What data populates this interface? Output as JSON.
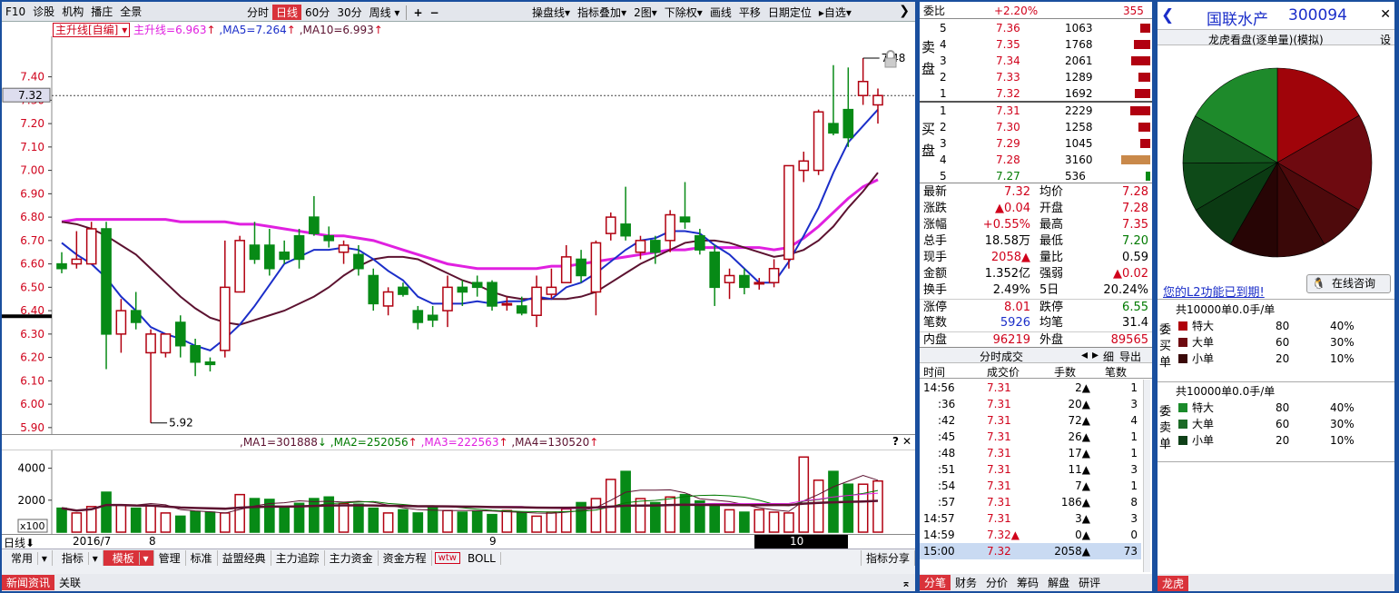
{
  "toolbar": {
    "left": [
      "F10",
      "诊股",
      "机构",
      "播庄",
      "全景"
    ],
    "periods": [
      "分时",
      "日线",
      "60分",
      "30分",
      "周线"
    ],
    "active_period": "日线",
    "zoom_in": "+",
    "zoom_out": "−",
    "right": [
      "操盘线",
      "指标叠加",
      "2图",
      "下除权",
      "画线",
      "平移",
      "日期定位",
      "自选"
    ],
    "collapse": "❯"
  },
  "legend": {
    "main_box": "主升线[自编]",
    "items": [
      {
        "text": "主升线=6.963",
        "color": "#e020e0",
        "arrow": "↑"
      },
      {
        "text": "MA5=7.264",
        "color": "#1b2ec9",
        "arrow": "↑"
      },
      {
        "text": "MA10=6.993",
        "color": "#5c1230",
        "arrow": "↑"
      }
    ]
  },
  "price_axis": {
    "labels": [
      "7.40",
      "7.30",
      "7.20",
      "7.10",
      "7.00",
      "6.90",
      "6.80",
      "6.70",
      "6.60",
      "6.50",
      "6.40",
      "6.30",
      "6.20",
      "6.10",
      "6.00",
      "5.90"
    ],
    "current": "7.32",
    "high_label": "7.48",
    "low_label": "5.92"
  },
  "chart_data": {
    "type": "candlestick",
    "ohlc": [
      [
        6.6,
        6.65,
        6.56,
        6.58
      ],
      [
        6.6,
        6.74,
        6.58,
        6.62
      ],
      [
        6.6,
        6.78,
        6.6,
        6.75
      ],
      [
        6.75,
        6.78,
        6.15,
        6.3
      ],
      [
        6.3,
        6.45,
        6.22,
        6.4
      ],
      [
        6.4,
        6.48,
        6.32,
        6.35
      ],
      [
        6.22,
        6.32,
        5.92,
        6.3
      ],
      [
        6.22,
        6.3,
        6.2,
        6.3
      ],
      [
        6.35,
        6.38,
        6.2,
        6.25
      ],
      [
        6.25,
        6.28,
        6.12,
        6.18
      ],
      [
        6.18,
        6.2,
        6.14,
        6.17
      ],
      [
        6.23,
        6.7,
        6.2,
        6.5
      ],
      [
        6.48,
        6.72,
        6.48,
        6.7
      ],
      [
        6.68,
        6.78,
        6.6,
        6.62
      ],
      [
        6.68,
        6.75,
        6.55,
        6.58
      ],
      [
        6.65,
        6.7,
        6.6,
        6.62
      ],
      [
        6.72,
        6.75,
        6.58,
        6.62
      ],
      [
        6.8,
        6.89,
        6.72,
        6.73
      ],
      [
        6.72,
        6.76,
        6.67,
        6.7
      ],
      [
        6.65,
        6.7,
        6.6,
        6.68
      ],
      [
        6.64,
        6.68,
        6.55,
        6.58
      ],
      [
        6.55,
        6.58,
        6.4,
        6.43
      ],
      [
        6.42,
        6.5,
        6.38,
        6.48
      ],
      [
        6.5,
        6.52,
        6.46,
        6.47
      ],
      [
        6.4,
        6.42,
        6.32,
        6.35
      ],
      [
        6.38,
        6.42,
        6.33,
        6.36
      ],
      [
        6.4,
        6.55,
        6.33,
        6.5
      ],
      [
        6.5,
        6.53,
        6.42,
        6.48
      ],
      [
        6.52,
        6.55,
        6.46,
        6.5
      ],
      [
        6.52,
        6.53,
        6.4,
        6.42
      ],
      [
        6.43,
        6.46,
        6.4,
        6.43
      ],
      [
        6.42,
        6.46,
        6.38,
        6.39
      ],
      [
        6.38,
        6.55,
        6.33,
        6.5
      ],
      [
        6.47,
        6.58,
        6.45,
        6.5
      ],
      [
        6.52,
        6.68,
        6.52,
        6.63
      ],
      [
        6.62,
        6.66,
        6.52,
        6.55
      ],
      [
        6.48,
        6.7,
        6.38,
        6.69
      ],
      [
        6.73,
        6.82,
        6.7,
        6.8
      ],
      [
        6.77,
        6.93,
        6.7,
        6.72
      ],
      [
        6.65,
        6.72,
        6.62,
        6.7
      ],
      [
        6.7,
        6.72,
        6.6,
        6.65
      ],
      [
        6.7,
        6.83,
        6.65,
        6.81
      ],
      [
        6.8,
        6.95,
        6.75,
        6.78
      ],
      [
        6.72,
        6.75,
        6.64,
        6.66
      ],
      [
        6.65,
        6.68,
        6.42,
        6.5
      ],
      [
        6.52,
        6.58,
        6.45,
        6.55
      ],
      [
        6.55,
        6.58,
        6.47,
        6.5
      ],
      [
        6.52,
        6.54,
        6.49,
        6.52
      ],
      [
        6.52,
        6.62,
        6.5,
        6.58
      ],
      [
        6.62,
        7.02,
        6.58,
        7.02
      ],
      [
        7.0,
        7.08,
        6.95,
        7.04
      ],
      [
        7.0,
        7.26,
        6.98,
        7.25
      ],
      [
        7.2,
        7.45,
        7.15,
        7.16
      ],
      [
        7.26,
        7.44,
        7.1,
        7.14
      ],
      [
        7.32,
        7.48,
        7.28,
        7.38
      ],
      [
        7.28,
        7.35,
        7.2,
        7.32
      ]
    ],
    "ma5": [
      6.69,
      6.64,
      6.6,
      6.54,
      6.46,
      6.4,
      6.33,
      6.3,
      6.28,
      6.25,
      6.23,
      6.28,
      6.34,
      6.42,
      6.51,
      6.6,
      6.63,
      6.66,
      6.66,
      6.67,
      6.66,
      6.62,
      6.57,
      6.53,
      6.46,
      6.43,
      6.43,
      6.43,
      6.44,
      6.43,
      6.44,
      6.44,
      6.46,
      6.45,
      6.5,
      6.52,
      6.56,
      6.61,
      6.66,
      6.7,
      6.71,
      6.74,
      6.74,
      6.73,
      6.68,
      6.64,
      6.58,
      6.52,
      6.52,
      6.61,
      6.72,
      6.84,
      6.99,
      7.12,
      7.19,
      7.26
    ],
    "ma10": [
      6.78,
      6.77,
      6.75,
      6.72,
      6.68,
      6.64,
      6.58,
      6.52,
      6.46,
      6.41,
      6.37,
      6.35,
      6.34,
      6.36,
      6.38,
      6.4,
      6.43,
      6.46,
      6.5,
      6.55,
      6.59,
      6.62,
      6.63,
      6.63,
      6.62,
      6.59,
      6.56,
      6.53,
      6.51,
      6.48,
      6.46,
      6.45,
      6.45,
      6.45,
      6.45,
      6.46,
      6.48,
      6.52,
      6.56,
      6.6,
      6.63,
      6.66,
      6.69,
      6.7,
      6.7,
      6.69,
      6.67,
      6.65,
      6.63,
      6.64,
      6.66,
      6.7,
      6.76,
      6.84,
      6.91,
      6.99
    ],
    "main": [
      6.78,
      6.79,
      6.79,
      6.79,
      6.79,
      6.79,
      6.79,
      6.79,
      6.78,
      6.78,
      6.78,
      6.78,
      6.77,
      6.77,
      6.76,
      6.75,
      6.74,
      6.73,
      6.72,
      6.72,
      6.71,
      6.7,
      6.68,
      6.66,
      6.64,
      6.62,
      6.6,
      6.59,
      6.58,
      6.58,
      6.58,
      6.58,
      6.58,
      6.59,
      6.59,
      6.6,
      6.61,
      6.62,
      6.63,
      6.64,
      6.65,
      6.66,
      6.66,
      6.67,
      6.67,
      6.67,
      6.67,
      6.67,
      6.66,
      6.67,
      6.71,
      6.76,
      6.82,
      6.88,
      6.93,
      6.96
    ],
    "volume": [
      1500,
      1200,
      1600,
      2500,
      1700,
      1500,
      1650,
      1200,
      1000,
      1300,
      1250,
      1200,
      2350,
      2100,
      2050,
      1500,
      1800,
      2100,
      2200,
      1800,
      1750,
      1500,
      1200,
      1400,
      1200,
      1600,
      1350,
      1250,
      1300,
      1100,
      1350,
      1200,
      1000,
      1250,
      1450,
      1850,
      2100,
      3300,
      3800,
      2100,
      1850,
      2200,
      2350,
      1950,
      1650,
      1400,
      1250,
      1400,
      1250,
      1200,
      4700,
      3250,
      3800,
      3000,
      3000,
      3200
    ],
    "vol_ylim": [
      0,
      5000
    ],
    "ylim": [
      5.88,
      7.48
    ]
  },
  "volume_panel": {
    "legend": [
      {
        "text": "MA1=301888",
        "color": "#5c1230",
        "arrow": "↓"
      },
      {
        "text": "MA2=252056",
        "color": "#007a00",
        "arrow": "↑"
      },
      {
        "text": "MA3=222563",
        "color": "#e020e0",
        "arrow": "↑"
      },
      {
        "text": "MA4=130520",
        "color": "#5c1230",
        "arrow": "↑"
      }
    ],
    "y_labels": [
      "4000",
      "2000"
    ],
    "unit": "x100"
  },
  "time_axis": {
    "period": "日线",
    "labels": [
      "2016/7",
      "8",
      "9",
      "10"
    ]
  },
  "bottom_tabs": [
    "常用",
    "指标",
    "模板",
    "管理",
    "标准",
    "益盟经典",
    "主力追踪",
    "主力资金",
    "资金方程",
    "wtw",
    "BOLL",
    "指标分享"
  ],
  "news_tabs": [
    "新闻资讯",
    "关联"
  ],
  "quote": {
    "weibi_label": "委比",
    "weibi_value": "+2.20%",
    "weibi_count": "355",
    "sell_label": [
      "卖",
      "盘"
    ],
    "buy_label": [
      "买",
      "盘"
    ],
    "sells": [
      {
        "n": "5",
        "price": "7.36",
        "vol": "1063",
        "bar": 0.34
      },
      {
        "n": "4",
        "price": "7.35",
        "vol": "1768",
        "bar": 0.56
      },
      {
        "n": "3",
        "price": "7.34",
        "vol": "2061",
        "bar": 0.65
      },
      {
        "n": "2",
        "price": "7.33",
        "vol": "1289",
        "bar": 0.41
      },
      {
        "n": "1",
        "price": "7.32",
        "vol": "1692",
        "bar": 0.53
      }
    ],
    "buys": [
      {
        "n": "1",
        "price": "7.31",
        "vol": "2229",
        "bar": 0.7
      },
      {
        "n": "2",
        "price": "7.30",
        "vol": "1258",
        "bar": 0.4
      },
      {
        "n": "3",
        "price": "7.29",
        "vol": "1045",
        "bar": 0.33
      },
      {
        "n": "4",
        "price": "7.28",
        "vol": "3160",
        "bar": 1.0
      },
      {
        "n": "5",
        "price": "7.27",
        "vol": "536",
        "bar": 0.17
      }
    ],
    "stats": [
      [
        "最新",
        "7.32",
        "均价",
        "7.28"
      ],
      [
        "涨跌",
        "▲0.04",
        "开盘",
        "7.28"
      ],
      [
        "涨幅",
        "+0.55%",
        "最高",
        "7.35"
      ],
      [
        "总手",
        "18.58万",
        "最低",
        "7.20"
      ],
      [
        "现手",
        "2058▲",
        "量比",
        "0.59"
      ],
      [
        "金额",
        "1.352亿",
        "强弱",
        "▲0.02"
      ],
      [
        "换手",
        "2.49%",
        "5日",
        "20.24%"
      ],
      [
        "涨停",
        "8.01",
        "跌停",
        "6.55"
      ],
      [
        "笔数",
        "5926",
        "均笔",
        "31.4"
      ],
      [
        "内盘",
        "96219",
        "外盘",
        "89565"
      ]
    ],
    "trades_title": "分时成交",
    "trades_detail": "细",
    "trades_export": "导出",
    "trades_headers": [
      "时间",
      "成交价",
      "手数",
      "笔数"
    ],
    "trades": [
      [
        "14:56",
        "7.31",
        "2▲",
        "1"
      ],
      [
        ":36",
        "7.31",
        "20▲",
        "3"
      ],
      [
        ":42",
        "7.31",
        "72▲",
        "4"
      ],
      [
        ":45",
        "7.31",
        "26▲",
        "1"
      ],
      [
        ":48",
        "7.31",
        "17▲",
        "1"
      ],
      [
        ":51",
        "7.31",
        "11▲",
        "3"
      ],
      [
        ":54",
        "7.31",
        "7▲",
        "1"
      ],
      [
        ":57",
        "7.31",
        "186▲",
        "8"
      ],
      [
        "14:57",
        "7.31",
        "3▲",
        "3"
      ],
      [
        "14:59",
        "7.32▲",
        "0▲",
        "0"
      ],
      [
        "15:00",
        "7.32",
        "2058▲",
        "73"
      ]
    ],
    "bottom_tabs": [
      "分笔",
      "财务",
      "分价",
      "筹码",
      "解盘",
      "研评"
    ]
  },
  "dragon": {
    "back": "❮",
    "stock_name": "国联水产",
    "stock_code": "300094",
    "title": "龙虎看盘(逐单量)(模拟)",
    "setting": "设",
    "expired": "您的L2功能已到期!",
    "consult": "在线咨询",
    "pie": [
      0.167,
      0.167,
      0.083,
      0.083,
      0.083,
      0.083,
      0.083,
      0.083,
      0.168
    ],
    "pie_colors": [
      "#a0040a",
      "#6e0a10",
      "#4e0a0c",
      "#3a0808",
      "#270505",
      "#0b3a13",
      "#0e4a18",
      "#13581e",
      "#1e8a2b"
    ],
    "buy_group": {
      "head": "共10000单0.0手/单",
      "side": [
        "委",
        "买",
        "单"
      ],
      "rows": [
        [
          "特大",
          "80",
          "40%",
          "#b0000a"
        ],
        [
          "大单",
          "60",
          "30%",
          "#6e0a10"
        ],
        [
          "小单",
          "20",
          "10%",
          "#3a0808"
        ]
      ]
    },
    "sell_group": {
      "head": "共10000单0.0手/单",
      "side": [
        "委",
        "卖",
        "单"
      ],
      "rows": [
        [
          "特大",
          "80",
          "40%",
          "#1a8a2a"
        ],
        [
          "大单",
          "60",
          "30%",
          "#1b6a26"
        ],
        [
          "小单",
          "20",
          "10%",
          "#0f4018"
        ]
      ]
    },
    "bottom_tab": "龙虎"
  }
}
